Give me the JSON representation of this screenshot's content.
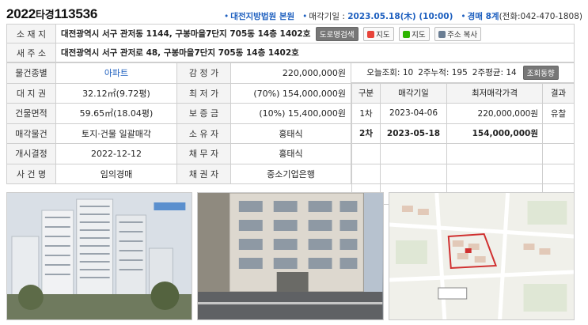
{
  "header": {
    "case_year": "2022",
    "case_type": "타경",
    "case_number": "113536",
    "court": "대전지방법원 본원",
    "sale_date_label": "매각기일 : ",
    "sale_date_value": "2023.05.18(木) (10:00)",
    "division": "경매 8계",
    "phone": "(전화:042-470-1808)"
  },
  "address": {
    "location_label": "소 재 지",
    "location_value": "대전광역시 서구 관저동 1144, 구봉마을7단지 705동 14층 1402호",
    "road_search_btn": "도로명검색",
    "map_btn_1": "지도",
    "map_btn_2": "지도",
    "copy_btn": "주소 복사",
    "new_address_label": "새 주 소",
    "new_address_value": "대전광역시 서구 관저로 48, 구봉마을7단지 705동 14층 1402호"
  },
  "details": {
    "rows": [
      {
        "l1": "물건종별",
        "v1": "아파트",
        "l2": "감 정 가",
        "v2": "220,000,000원"
      },
      {
        "l1": "대 지 권",
        "v1": "32.12㎡(9.72평)",
        "l2": "최 저 가",
        "v2": "(70%) 154,000,000원"
      },
      {
        "l1": "건물면적",
        "v1": "59.65㎡(18.04평)",
        "l2": "보 증 금",
        "v2": "(10%) 15,400,000원"
      },
      {
        "l1": "매각물건",
        "v1": "토지·건물 일괄매각",
        "l2": "소 유 자",
        "v2": "홍태식"
      },
      {
        "l1": "개시결정",
        "v1": "2022-12-12",
        "l2": "채 무 자",
        "v2": "홍태식"
      },
      {
        "l1": "사 건 명",
        "v1": "임의경매",
        "l2": "채 권 자",
        "v2": "중소기업은행"
      }
    ]
  },
  "stats": {
    "today_label": "오늘조회:",
    "today_value": "10",
    "two_week_label": "2주누적:",
    "two_week_value": "195",
    "two_week_avg_label": "2주평균:",
    "two_week_avg_value": "14",
    "trend_btn": "조회동향"
  },
  "bids": {
    "headers": [
      "구분",
      "매각기일",
      "최저매각가격",
      "결과"
    ],
    "rows": [
      {
        "round": "1차",
        "date": "2023-04-06",
        "price": "220,000,000원",
        "result": "유찰"
      },
      {
        "round": "2차",
        "date": "2023-05-18",
        "price": "154,000,000원",
        "result": ""
      }
    ]
  },
  "colors": {
    "accent_blue": "#1d5fbf",
    "label_bg": "#f4f4f4",
    "border": "#cfcfcf"
  }
}
